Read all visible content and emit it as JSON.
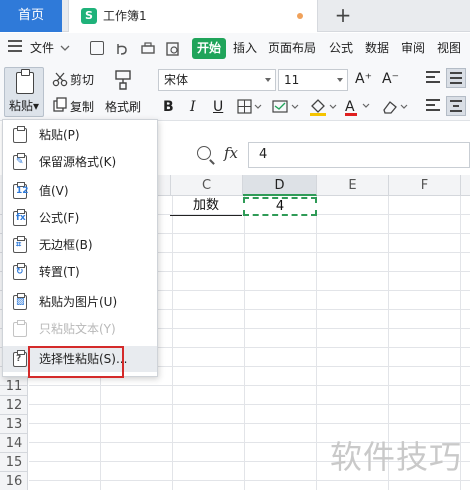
{
  "tabs": {
    "home_label": "首页",
    "doc_title": "工作簿1",
    "doc_logo": "S",
    "add_tab_symbol": "+"
  },
  "menubar": {
    "file_label": "文件",
    "items": [
      "开始",
      "插入",
      "页面布局",
      "公式",
      "数据",
      "审阅",
      "视图"
    ],
    "active": "开始"
  },
  "toolbar": {
    "paste_label": "粘贴",
    "cut_label": "剪切",
    "copy_label": "复制",
    "format_painter_label": "格式刷",
    "font_name": "宋体",
    "font_size": "11",
    "bold": "B",
    "italic": "I",
    "underline": "U",
    "grow_font": "A⁺",
    "shrink_font": "A⁻",
    "font_color_glyph": "A"
  },
  "formula_bar": {
    "fx_label": "fx",
    "value": "4"
  },
  "grid": {
    "columns": [
      "C",
      "D",
      "E",
      "F"
    ],
    "rows": [
      "11",
      "12",
      "13",
      "14",
      "15",
      "16"
    ],
    "cells": {
      "C1": "加数",
      "D1": "4"
    }
  },
  "paste_menu": {
    "items": [
      {
        "label": "粘贴(P)",
        "enabled": true
      },
      {
        "label": "保留源格式(K)",
        "enabled": true
      },
      {
        "label": "值(V)",
        "enabled": true
      },
      {
        "label": "公式(F)",
        "enabled": true
      },
      {
        "label": "无边框(B)",
        "enabled": true
      },
      {
        "label": "转置(T)",
        "enabled": true
      },
      {
        "label": "粘贴为图片(U)",
        "enabled": true
      },
      {
        "label": "只粘贴文本(Y)",
        "enabled": false
      },
      {
        "label": "选择性粘贴(S)...",
        "enabled": true
      }
    ],
    "highlighted": "选择性粘贴(S)..."
  },
  "watermark": "软件技巧",
  "colors": {
    "accent_blue": "#2f7ad9",
    "start_green": "#1fa45a",
    "selection_green": "#2f9b57",
    "highlight_red": "#d42a2a"
  }
}
